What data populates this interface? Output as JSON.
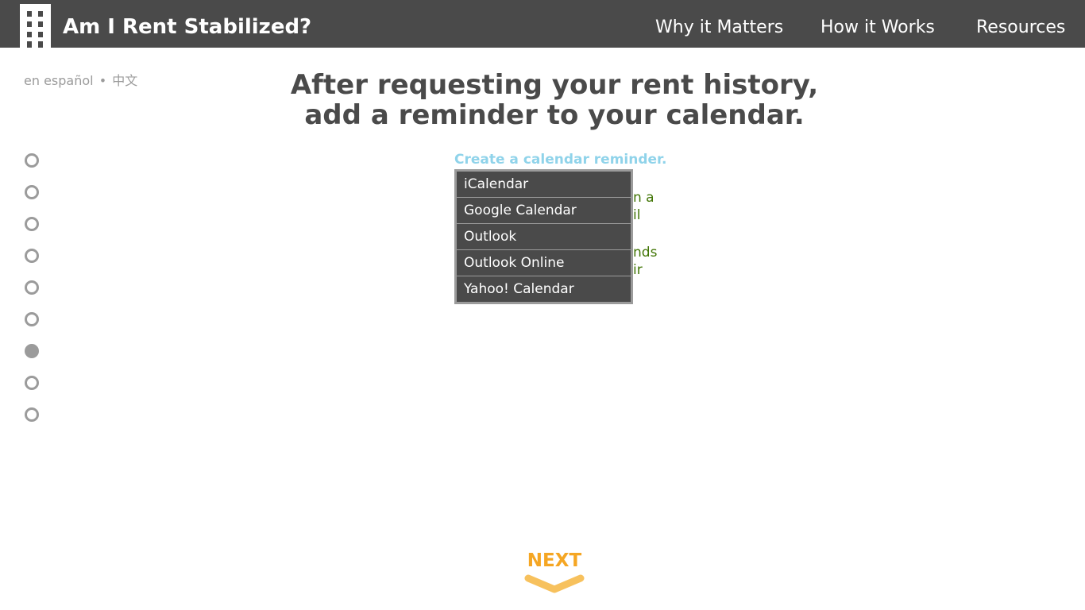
{
  "header": {
    "title": "Am I Rent Stabilized?",
    "nav": [
      {
        "label": "Why it Matters"
      },
      {
        "label": "How it Works"
      },
      {
        "label": "Resources"
      }
    ]
  },
  "language": {
    "spanish": "en español",
    "separator": "•",
    "chinese": "中文"
  },
  "steps": {
    "total": 9,
    "active_index": 6
  },
  "main": {
    "headline_line1": "After requesting your rent history,",
    "headline_line2": "add a reminder to your calendar.",
    "reminder_link": "Create a calendar reminder.",
    "partial_text": [
      "n a",
      "il",
      "nds",
      "ir"
    ]
  },
  "calendar_menu": {
    "options": [
      {
        "label": "iCalendar"
      },
      {
        "label": "Google Calendar"
      },
      {
        "label": "Outlook"
      },
      {
        "label": "Outlook Online"
      },
      {
        "label": "Yahoo! Calendar"
      }
    ]
  },
  "footer": {
    "next_label": "NEXT"
  },
  "colors": {
    "header_bg": "#4a4a4a",
    "accent_orange": "#f5a623",
    "link_blue": "#8fd3ea",
    "text_green": "#417505",
    "muted_gray": "#9b9b9b"
  },
  "icons": {
    "logo": "building-icon",
    "next": "chevron-down-icon"
  }
}
